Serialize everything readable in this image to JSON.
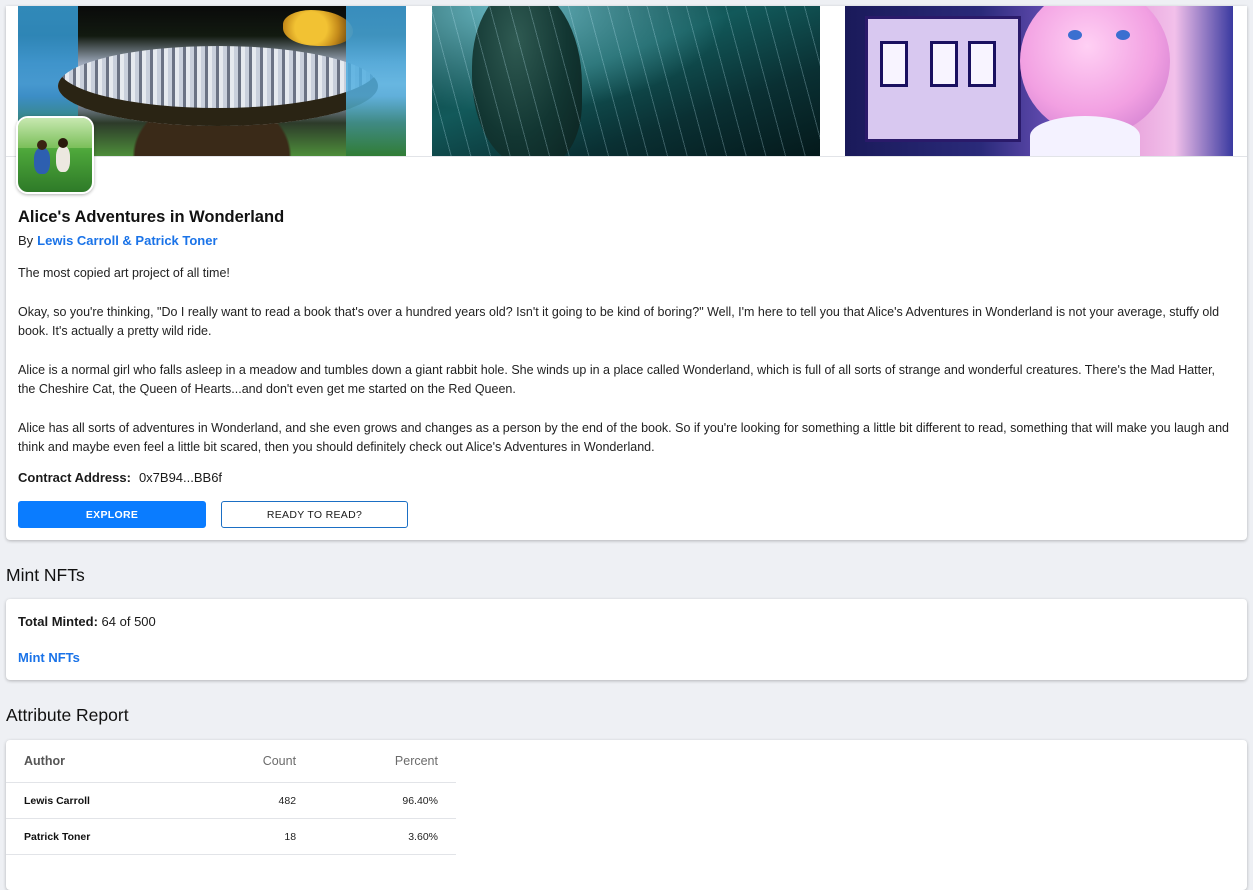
{
  "project": {
    "title": "Alice's Adventures in Wonderland",
    "by_label": "By",
    "artist": "Lewis Carroll & Patrick Toner",
    "description": [
      "The most copied art project of all time!",
      "Okay, so you're thinking, \"Do I really want to read a book that's over a hundred years old? Isn't it going to be kind of boring?\" Well, I'm here to tell you that Alice's Adventures in Wonderland is not your average, stuffy old book. It's actually a pretty wild ride.",
      "Alice is a normal girl who falls asleep in a meadow and tumbles down a giant rabbit hole. She winds up in a place called Wonderland, which is full of all sorts of strange and wonderful creatures. There's the Mad Hatter, the Cheshire Cat, the Queen of Hearts...and don't even get me started on the Red Queen.",
      "Alice has all sorts of adventures in Wonderland, and she even grows and changes as a person by the end of the book. So if you're looking for something a little bit different to read, something that will make you laugh and think and maybe even feel a little bit scared, then you should definitely check out Alice's Adventures in Wonderland."
    ],
    "contract_label": "Contract Address:",
    "contract_address": "0x7B94...BB6f",
    "explore_label": "EXPLORE",
    "read_label": "READY TO READ?"
  },
  "mint": {
    "heading": "Mint NFTs",
    "total_label": "Total Minted:",
    "total_value": "64 of 500",
    "link_label": "Mint NFTs"
  },
  "attributes": {
    "heading": "Attribute Report",
    "columns": [
      "Author",
      "Count",
      "Percent"
    ],
    "rows": [
      {
        "name": "Lewis Carroll",
        "count": "482",
        "percent": "96.40%"
      },
      {
        "name": "Patrick Toner",
        "count": "18",
        "percent": "3.60%"
      }
    ]
  },
  "colors": {
    "accent": "#0a7cff",
    "link": "#1a73e8",
    "background": "#eef0f4"
  }
}
